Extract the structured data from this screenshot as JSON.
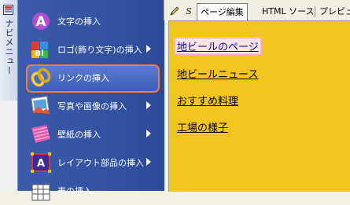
{
  "navi_tab": {
    "label": "ナビメニュー",
    "icon": "navi-icon"
  },
  "menu": {
    "items": [
      {
        "label": "文字の挿入",
        "icon": "text-insert-icon",
        "has_submenu": false,
        "selected": false
      },
      {
        "label": "ロゴ(飾り文字)の挿入",
        "icon": "logo-insert-icon",
        "has_submenu": true,
        "selected": false
      },
      {
        "label": "リンクの挿入",
        "icon": "link-chain-icon",
        "has_submenu": false,
        "selected": true
      },
      {
        "label": "写真や画像の挿入",
        "icon": "image-insert-icon",
        "has_submenu": true,
        "selected": false
      },
      {
        "label": "壁紙の挿入",
        "icon": "wallpaper-icon",
        "has_submenu": true,
        "selected": false
      },
      {
        "label": "レイアウト部品の挿入",
        "icon": "layout-parts-icon",
        "has_submenu": true,
        "selected": false
      },
      {
        "label": "表の挿入",
        "icon": "table-insert-icon",
        "has_submenu": false,
        "selected": false
      }
    ]
  },
  "tabs": {
    "items": [
      {
        "label": "ページ編集",
        "active": true
      },
      {
        "label": "HTML ソース",
        "active": false
      },
      {
        "label": "プレビュ",
        "active": false
      }
    ]
  },
  "content": {
    "links": [
      {
        "text": "地ビールのページ",
        "style": "highlight"
      },
      {
        "text": "地ビールニュース",
        "style": "plain"
      },
      {
        "text": "おすすめ料理",
        "style": "plain"
      },
      {
        "text": "工場の様子",
        "style": "plain"
      }
    ]
  },
  "colors": {
    "menu_bg": "#2c4a98",
    "selected_border": "#f08030",
    "content_bg": "#f2c51e",
    "link_highlight": "#0a0aa0"
  }
}
